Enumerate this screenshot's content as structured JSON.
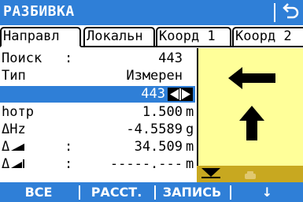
{
  "title": "РАЗБИВКА",
  "tabs": [
    "Направл",
    "Локальн",
    "Коорд 1",
    "Коорд 2"
  ],
  "fields": {
    "search": {
      "label": "Поиск",
      "value": "443"
    },
    "type": {
      "label": "Тип",
      "value": "Измерен"
    },
    "selected_value": "443",
    "hotr": {
      "label": "hотр",
      "value": "1.500",
      "unit": "m"
    },
    "dhz": {
      "label": "ΔHz",
      "value": "-4.5589",
      "unit": "g"
    },
    "dslope1": {
      "label": "Δ",
      "value": "34.509",
      "unit": "m"
    },
    "dslope2": {
      "label": "Δ",
      "value": "-----.---",
      "unit": "m"
    }
  },
  "softkeys": [
    "ВСЕ",
    "РАССТ.",
    "ЗАПИСЬ",
    "↓"
  ]
}
